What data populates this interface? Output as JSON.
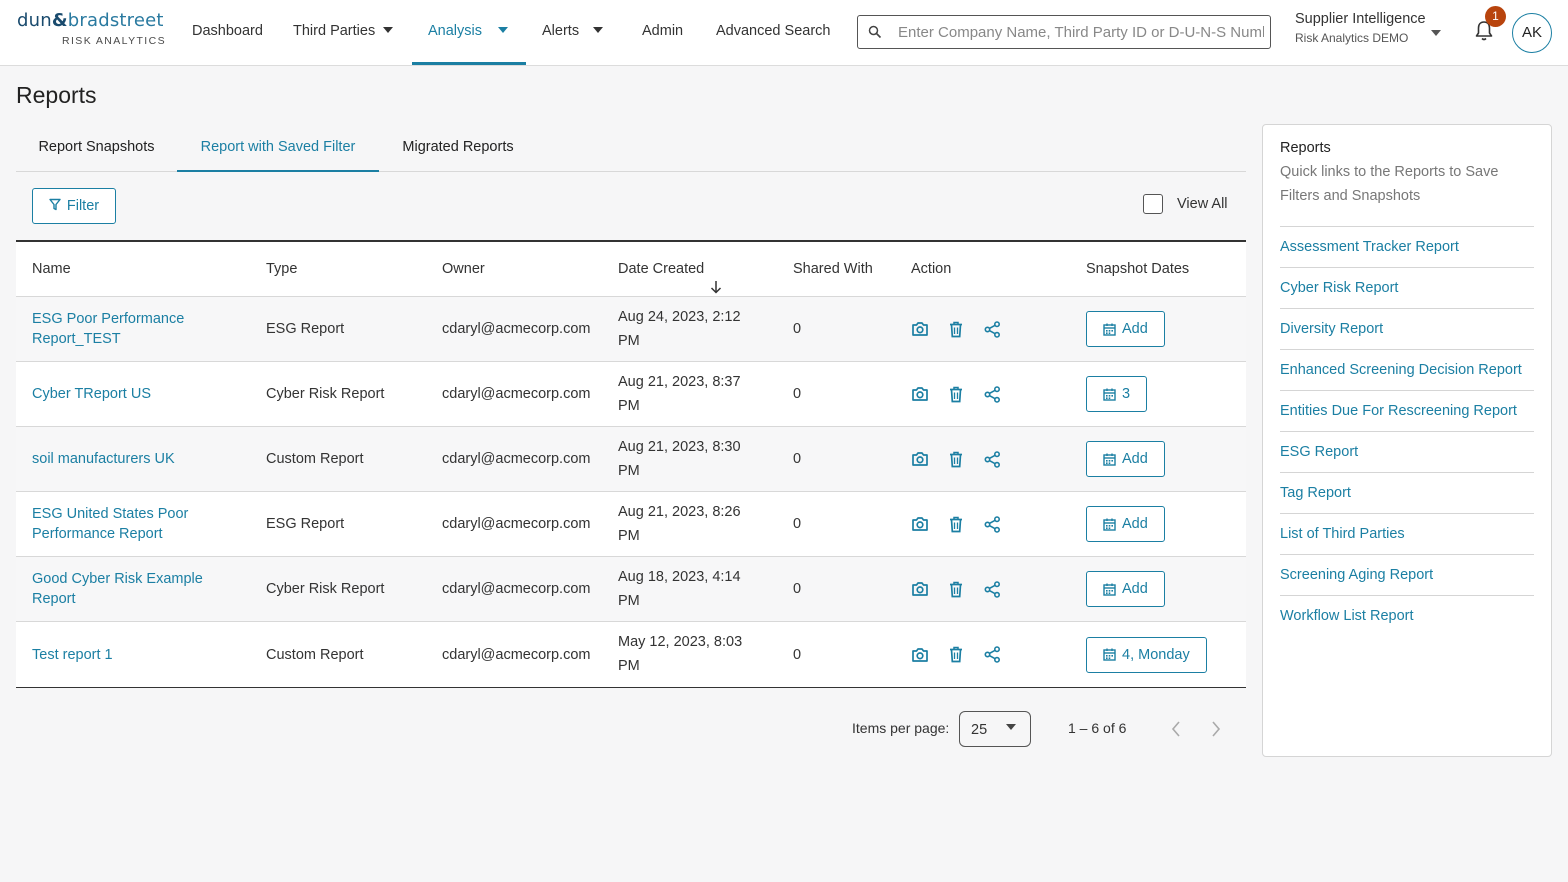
{
  "brand": {
    "logo_part1": "dun",
    "logo_amp": "&",
    "logo_part2": "bradstreet",
    "logo_sub": "RISK ANALYTICS"
  },
  "nav": {
    "items": [
      {
        "label": "Dashboard"
      },
      {
        "label": "Third Parties"
      },
      {
        "label": "Analysis"
      },
      {
        "label": "Alerts"
      },
      {
        "label": "Admin"
      },
      {
        "label": "Advanced Search"
      }
    ]
  },
  "search": {
    "placeholder": "Enter Company Name, Third Party ID or D-U-N-S Number",
    "value": ""
  },
  "org": {
    "title": "Supplier Intelligence",
    "subtitle": "Risk Analytics DEMO"
  },
  "notifications": {
    "count": "1"
  },
  "user": {
    "initials": "AK"
  },
  "page": {
    "title": "Reports"
  },
  "tabs": [
    {
      "label": "Report Snapshots"
    },
    {
      "label": "Report with Saved Filter"
    },
    {
      "label": "Migrated Reports"
    }
  ],
  "toolbar": {
    "filter_label": "Filter",
    "view_all_label": "View All"
  },
  "table": {
    "headers": {
      "name": "Name",
      "type": "Type",
      "owner": "Owner",
      "date_created": "Date Created",
      "shared_with": "Shared With",
      "action": "Action",
      "snapshot_dates": "Snapshot Dates"
    },
    "rows": [
      {
        "name": "ESG Poor Performance Report_TEST",
        "type": "ESG Report",
        "owner": "cdaryl@acmecorp.com",
        "date": "Aug 24, 2023, 2:12 PM",
        "shared": "0",
        "snapshot": "Add"
      },
      {
        "name": "Cyber TReport US",
        "type": "Cyber Risk Report",
        "owner": "cdaryl@acmecorp.com",
        "date": "Aug 21, 2023, 8:37 PM",
        "shared": "0",
        "snapshot": "3"
      },
      {
        "name": "soil manufacturers UK",
        "type": "Custom Report",
        "owner": "cdaryl@acmecorp.com",
        "date": "Aug 21, 2023, 8:30 PM",
        "shared": "0",
        "snapshot": "Add"
      },
      {
        "name": "ESG United States Poor Performance Report",
        "type": "ESG Report",
        "owner": "cdaryl@acmecorp.com",
        "date": "Aug 21, 2023, 8:26 PM",
        "shared": "0",
        "snapshot": "Add"
      },
      {
        "name": "Good Cyber Risk Example Report",
        "type": "Cyber Risk Report",
        "owner": "cdaryl@acmecorp.com",
        "date": "Aug 18, 2023, 4:14 PM",
        "shared": "0",
        "snapshot": "Add"
      },
      {
        "name": "Test report 1",
        "type": "Custom Report",
        "owner": "cdaryl@acmecorp.com",
        "date": "May 12, 2023, 8:03 PM",
        "shared": "0",
        "snapshot": "4, Monday"
      }
    ]
  },
  "pagination": {
    "label": "Items per page:",
    "per_page": "25",
    "range": "1 – 6 of 6"
  },
  "sidebar": {
    "title": "Reports",
    "description": "Quick links to the Reports to Save Filters and Snapshots",
    "links": [
      {
        "label": "Assessment Tracker Report"
      },
      {
        "label": "Cyber Risk Report"
      },
      {
        "label": "Diversity Report"
      },
      {
        "label": "Enhanced Screening Decision Report"
      },
      {
        "label": "Entities Due For Rescreening Report"
      },
      {
        "label": "ESG Report"
      },
      {
        "label": "Tag Report"
      },
      {
        "label": "List of Third Parties"
      },
      {
        "label": "Screening Aging Report"
      },
      {
        "label": "Workflow List Report"
      }
    ]
  },
  "colors": {
    "accent": "#1b7fa3",
    "badge": "#b8440d",
    "brand_navy": "#1a4b6e"
  }
}
